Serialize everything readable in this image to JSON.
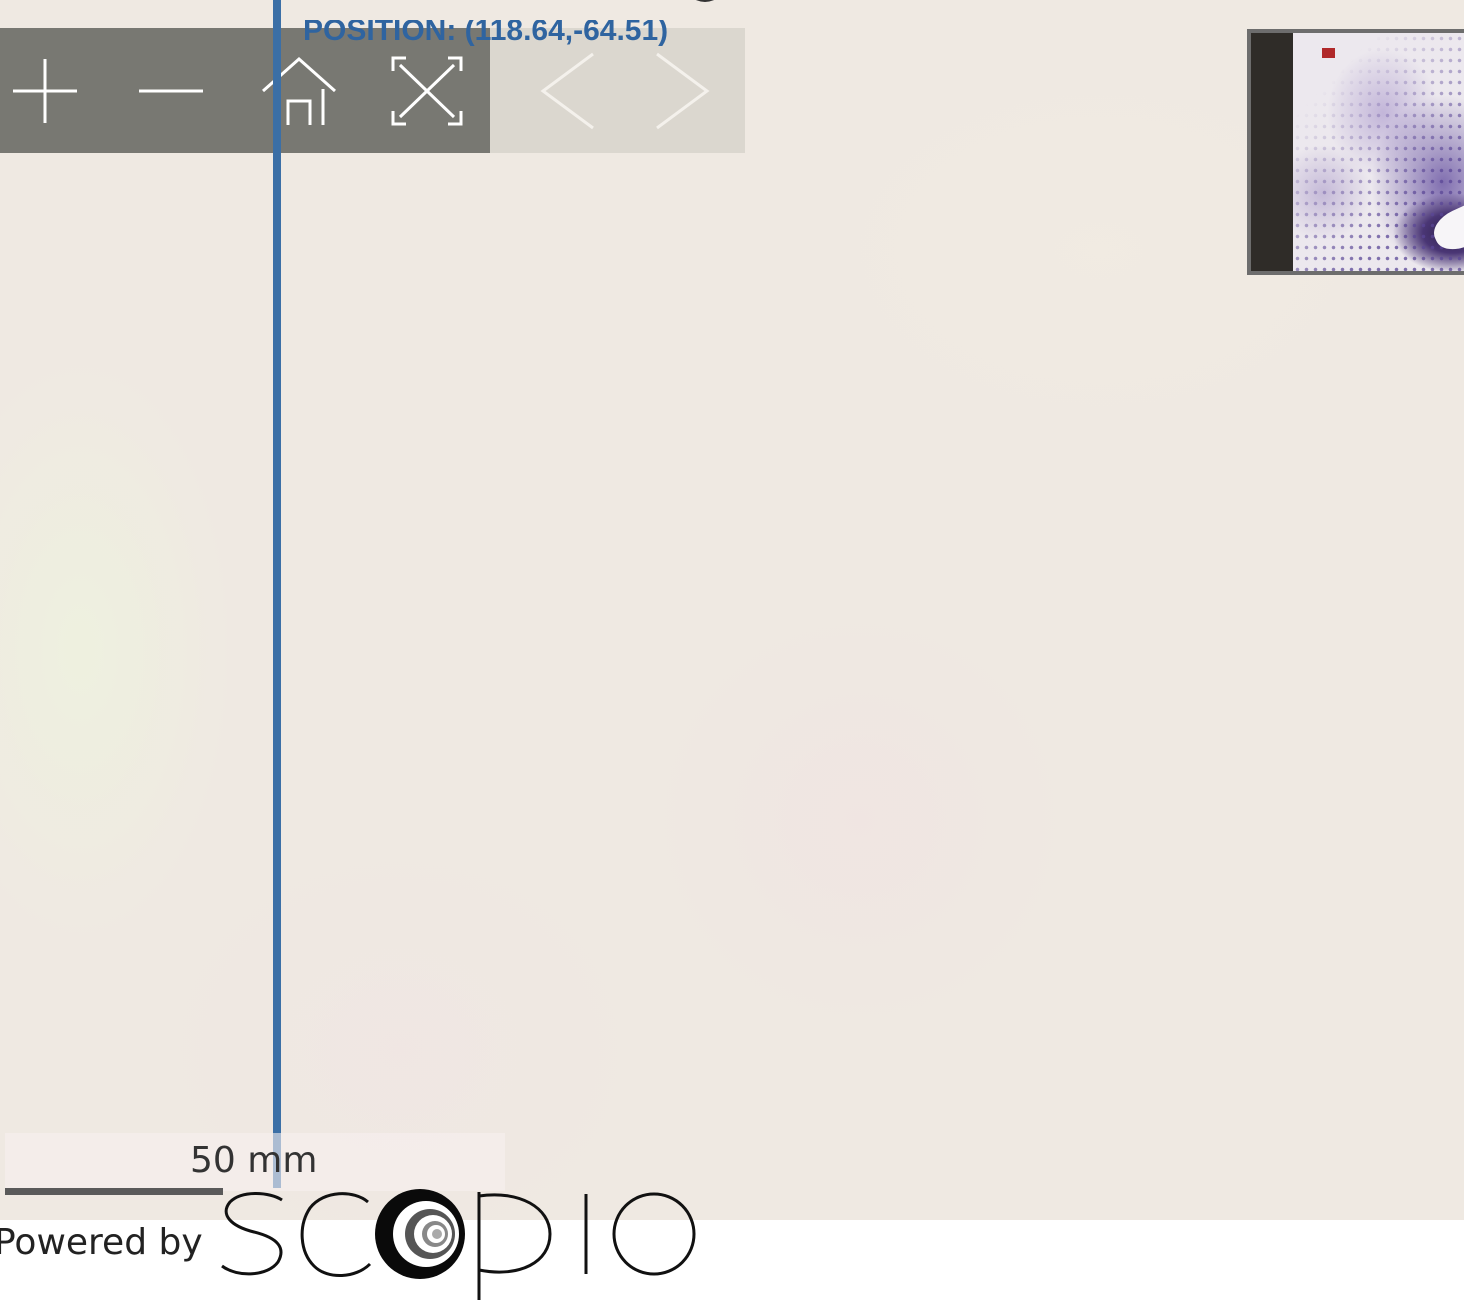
{
  "viewer": {
    "position_readout": "POSITION: (118.64,-64.51)",
    "scale_label": "50 mm"
  },
  "toolbar": {
    "buttons": [
      {
        "name": "zoom-in",
        "icon": "plus-icon"
      },
      {
        "name": "zoom-out",
        "icon": "minus-icon"
      },
      {
        "name": "home",
        "icon": "home-icon"
      },
      {
        "name": "fullscreen",
        "icon": "fullscreen-icon"
      },
      {
        "name": "previous",
        "icon": "chevron-left-icon",
        "enabled": false
      },
      {
        "name": "next",
        "icon": "chevron-right-icon",
        "enabled": false
      }
    ]
  },
  "footer": {
    "powered_by": "Powered by",
    "logo_text": "SCOPIO",
    "logo_icon": "scopio-logo"
  },
  "colors": {
    "accent": "#3b6fa6",
    "toolbar_bg": "#6e6e68",
    "nav_viewport": "#b0282a",
    "slide_bg": "#efe9e2"
  }
}
